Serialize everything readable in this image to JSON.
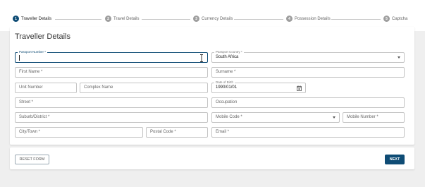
{
  "stepper": {
    "steps": [
      {
        "number": "1",
        "label": "Traveller Details",
        "active": true
      },
      {
        "number": "2",
        "label": "Travel Details",
        "active": false
      },
      {
        "number": "3",
        "label": "Currency Details",
        "active": false
      },
      {
        "number": "4",
        "label": "Possession Details",
        "active": false
      },
      {
        "number": "5",
        "label": "Captcha",
        "active": false
      }
    ]
  },
  "form": {
    "title": "Traveller Details",
    "passport_number": {
      "label": "Passport Number *",
      "value": ""
    },
    "passport_country": {
      "label": "Passport Country *",
      "value": "South Africa"
    },
    "first_name": {
      "placeholder": "First Name *"
    },
    "surname": {
      "placeholder": "Surname *"
    },
    "unit_number": {
      "placeholder": "Unit Number"
    },
    "complex_name": {
      "placeholder": "Complex Name"
    },
    "date_of_birth": {
      "label": "Date of Birth",
      "value": "1990/01/01"
    },
    "street": {
      "placeholder": "Street *"
    },
    "occupation": {
      "placeholder": "Occupation"
    },
    "suburb": {
      "placeholder": "Suburb/District *"
    },
    "mobile_code": {
      "placeholder": "Mobile Code *"
    },
    "mobile_number": {
      "placeholder": "Mobile Number *"
    },
    "city": {
      "placeholder": "City/Town *"
    },
    "postal_code": {
      "placeholder": "Postal Code *"
    },
    "email": {
      "placeholder": "Email *"
    }
  },
  "actions": {
    "reset_label": "RESET FORM",
    "next_label": "NEXT"
  },
  "colors": {
    "primary": "#0f4c75",
    "inactive_step": "#9e9e9e",
    "background": "#efefef"
  }
}
